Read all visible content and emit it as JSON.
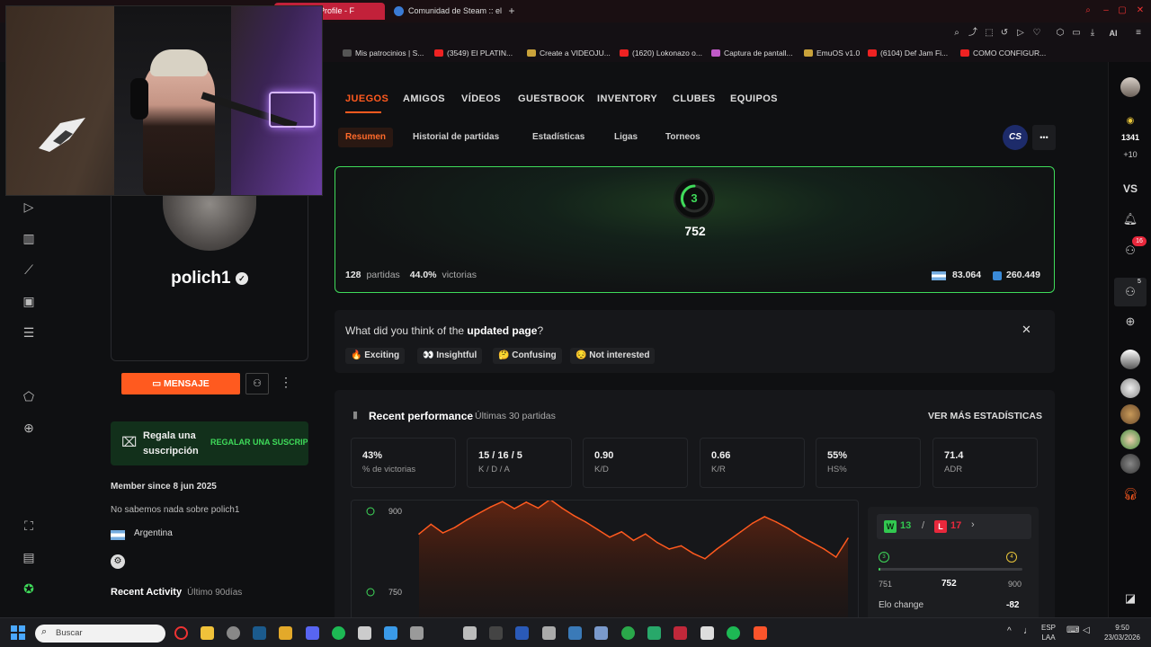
{
  "browser": {
    "tabs": [
      {
        "label": "Player Profile - F"
      },
      {
        "label": "Comunidad de Steam :: el"
      }
    ],
    "bookmarks": [
      {
        "label": "Mis patrocinios | S..."
      },
      {
        "label": "(3549) El PLATIN..."
      },
      {
        "label": "Create a VIDEOJU..."
      },
      {
        "label": "(1620) Lokonazo o..."
      },
      {
        "label": "Captura de pantall..."
      },
      {
        "label": "EmuOS v1.0"
      },
      {
        "label": "(6104) Def Jam Fi..."
      },
      {
        "label": "COMO CONFIGUR..."
      }
    ],
    "ai_label": "AI"
  },
  "nav": {
    "tabs": [
      "JUEGOS",
      "AMIGOS",
      "VÍDEOS",
      "GUESTBOOK",
      "INVENTORY",
      "CLUBES",
      "EQUIPOS"
    ],
    "subtabs": [
      "Resumen",
      "Historial de partidas",
      "Estadísticas",
      "Ligas",
      "Torneos"
    ],
    "game_badge": "CS",
    "more": "•••"
  },
  "elo_card": {
    "level": "3",
    "elo": "752",
    "matches_value": "128",
    "matches_label": "partidas",
    "win_value": "44.0%",
    "win_label": "victorias",
    "country_rank": "83.064",
    "region_rank": "260.449"
  },
  "feedback": {
    "question_pre": "What did you think of the",
    "question_bold": "updated page",
    "question_post": "?",
    "options": [
      "🔥 Exciting",
      "👀 Insightful",
      "🤔 Confusing",
      "😔 Not interested"
    ],
    "close": "✕"
  },
  "performance": {
    "title": "Recent performance",
    "subtitle": "Últimas 30 partidas",
    "more_link": "VER MÁS ESTADÍSTICAS",
    "stats": [
      {
        "value": "43%",
        "label": "% de victorias"
      },
      {
        "value": "15 / 16 / 5",
        "label": "K / D / A"
      },
      {
        "value": "0.90",
        "label": "K/D"
      },
      {
        "value": "0.66",
        "label": "K/R"
      },
      {
        "value": "55%",
        "label": "HS%"
      },
      {
        "value": "71.4",
        "label": "ADR"
      }
    ],
    "wins_label": "W",
    "wins": "13",
    "losses_label": "L",
    "losses": "17",
    "level_low": "3",
    "level_high": "4",
    "elo_low": "751",
    "elo_current": "752",
    "elo_high": "900",
    "elo_change_label": "Elo change",
    "elo_change": "-82"
  },
  "chart_data": {
    "type": "area",
    "title": "",
    "xlabel": "",
    "ylabel": "",
    "y_ticks": [
      900,
      750
    ],
    "ylim": [
      690,
      920
    ],
    "series": [
      {
        "values": [
          858,
          876,
          860,
          870,
          884,
          896,
          908,
          918,
          905,
          917,
          906,
          922,
          906,
          892,
          880,
          866,
          852,
          862,
          846,
          858,
          842,
          830,
          836,
          822,
          812,
          830,
          846,
          862,
          878,
          890,
          880,
          868,
          854,
          842,
          830,
          815,
          850
        ]
      }
    ]
  },
  "profile": {
    "username": "polich1",
    "message_button": "MENSAJE",
    "gift_title": "Regala una suscripción",
    "gift_button": "REGALAR UNA SUSCRIPCIÓN",
    "member_since": "Member since 8 jun 2025",
    "bio": "No sabemos nada sobre polich1",
    "country": "Argentina",
    "recent_activity": "Recent Activity",
    "recent_activity_sub": "Último 90días"
  },
  "rightbar": {
    "points": "1341",
    "plus": "+10",
    "vs": "VS",
    "friends_badge": "16",
    "party_badge": "5"
  },
  "taskbar": {
    "search_placeholder": "Buscar",
    "lang": "ESP",
    "lang2": "LAA",
    "time": "9:50",
    "date": "23/03/2026"
  },
  "colors": {
    "accent": "#ff5a1f",
    "elo_green": "#3fdb5a",
    "win_green": "#32c850",
    "loss_red": "#e8283c"
  }
}
